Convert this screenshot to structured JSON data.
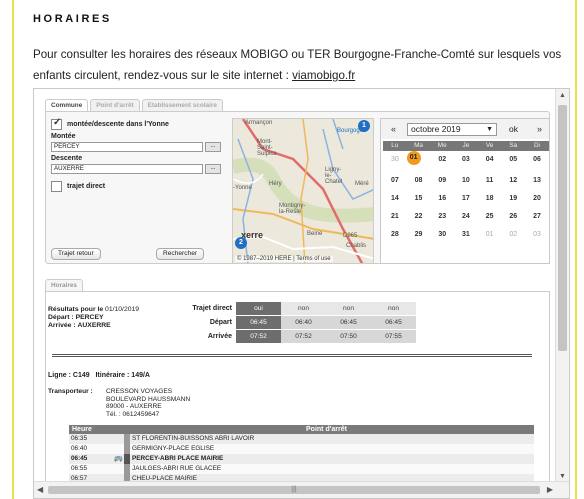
{
  "page": {
    "title": "HORAIRES",
    "intro_text": "Pour consulter les horaires des réseaux MOBIGO ou TER Bourgogne-Franche-Comté sur lesquels vos enfants circulent, rendez-vous sur le site internet : ",
    "intro_link": "viamobigo.fr"
  },
  "tabs": [
    {
      "label": "Commune",
      "active": true
    },
    {
      "label": "Point d'arrêt",
      "active": false
    },
    {
      "label": "Etablissement scolaire",
      "active": false
    }
  ],
  "form": {
    "checkbox_yonne_label": "montée/descente dans l'Yonne",
    "checkbox_yonne_checked": true,
    "montee_label": "Montée",
    "montee_value": "PERCEY",
    "descente_label": "Descente",
    "descente_value": "AUXERRE",
    "trajet_direct_label": "trajet direct",
    "trajet_direct_checked": false,
    "btn_ellipsis": "...",
    "btn_trajet_retour": "Trajet retour",
    "btn_rechercher": "Rechercher"
  },
  "map": {
    "labels": {
      "armancon": "Armançon",
      "bourgogne": "Bourgogne",
      "mont_saint_sulpice": "Mont-\nSaint-\nSulpice",
      "ligny": "Ligny-\nle-\nChatel",
      "hery": "Héry",
      "yonne": "-Yonne",
      "montigny": "Montigny-\nla-Resle",
      "mere": "Méré",
      "beine": "Beine",
      "chablis": "Chablis",
      "d965": "D965",
      "auxerre": "xerre"
    },
    "credit": "© 1987–2019 HERE | Terms of use",
    "pin1": "1",
    "pin2": "2"
  },
  "calendar": {
    "prev": "«",
    "next": "»",
    "month": "octobre 2019",
    "ok": "ok",
    "dow": [
      "Lu",
      "Ma",
      "Me",
      "Je",
      "Ve",
      "Sa",
      "Di"
    ],
    "weeks": [
      [
        "30",
        "01",
        "02",
        "03",
        "04",
        "05",
        "06"
      ],
      [
        "07",
        "08",
        "09",
        "10",
        "11",
        "12",
        "13"
      ],
      [
        "14",
        "15",
        "16",
        "17",
        "18",
        "19",
        "20"
      ],
      [
        "21",
        "22",
        "23",
        "24",
        "25",
        "26",
        "27"
      ],
      [
        "28",
        "29",
        "30",
        "31",
        "01",
        "02",
        "03"
      ]
    ],
    "selected": "01"
  },
  "results": {
    "tab_label": "Horaires",
    "results_label": "Résultats pour le",
    "date": "01/10/2019",
    "depart_label": "Départ :",
    "depart_value": "PERCEY",
    "arrivee_label": "Arrivée :",
    "arrivee_value": "AUXERRE",
    "row_labels": {
      "trajet_direct": "Trajet direct",
      "depart": "Départ",
      "arrivee": "Arrivée"
    },
    "options": [
      {
        "direct": "oui",
        "depart": "06:45",
        "arrivee": "07:52"
      },
      {
        "direct": "non",
        "depart": "06:40",
        "arrivee": "07:52"
      },
      {
        "direct": "non",
        "depart": "06:45",
        "arrivee": "07:50"
      },
      {
        "direct": "non",
        "depart": "06:45",
        "arrivee": "07:55"
      }
    ]
  },
  "detail": {
    "ligne_label": "Ligne :",
    "ligne_value": "C149",
    "itineraire_label": "Itinéraire :",
    "itineraire_value": "149/A",
    "transporteur_label": "Transporteur :",
    "transporteur_lines": [
      "CRESSON VOYAGES",
      "BOULEVARD HAUSSMANN",
      "89000 - AUXERRE",
      "Tél. : 0612459647"
    ],
    "stops_header": {
      "heure": "Heure",
      "point": "Point d'arrêt"
    },
    "stops": [
      {
        "time": "06:35",
        "name": "ST FLORENTIN-BUISSONS ABRI LAVOIR",
        "highlight": false
      },
      {
        "time": "06:40",
        "name": "GERMIGNY-PLACE EGLISE",
        "highlight": false
      },
      {
        "time": "06:45",
        "name": "PERCEY-ABRI PLACE MAIRIE",
        "highlight": true
      },
      {
        "time": "06:55",
        "name": "JAULGES-ABRI RUE GLACEE",
        "highlight": false
      },
      {
        "time": "06:57",
        "name": "CHEU-PLACE MAIRIE",
        "highlight": false
      }
    ]
  },
  "colors": {
    "accent_yellow": "#e8e24e",
    "selected_day": "#f29a1d",
    "pin_blue": "#1f6fc2"
  }
}
